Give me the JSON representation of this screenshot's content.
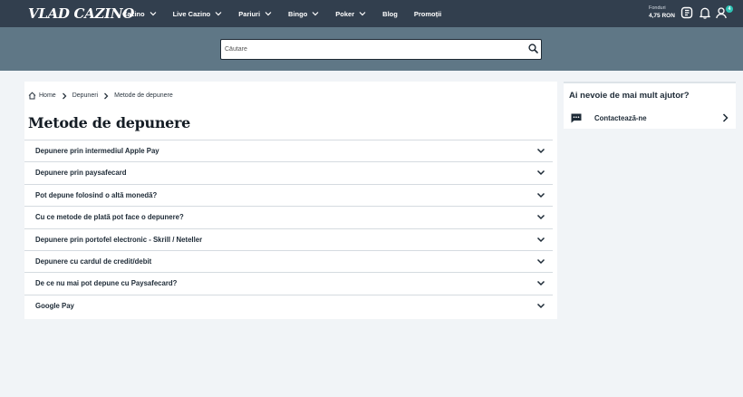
{
  "brand": {
    "logo_text": "VLAD CAZINO"
  },
  "nav": {
    "items": [
      {
        "label": "Cazino",
        "has_dropdown": true
      },
      {
        "label": "Live Cazino",
        "has_dropdown": true
      },
      {
        "label": "Pariuri",
        "has_dropdown": true
      },
      {
        "label": "Bingo",
        "has_dropdown": true
      },
      {
        "label": "Poker",
        "has_dropdown": true
      },
      {
        "label": "Blog",
        "has_dropdown": false
      },
      {
        "label": "Promoții",
        "has_dropdown": false
      }
    ]
  },
  "account": {
    "funds_label": "Fonduri",
    "funds_value": "4,75 RON",
    "notification_badge": "4",
    "icons": [
      "bonus-icon",
      "bell-icon",
      "user-icon"
    ]
  },
  "search": {
    "placeholder": "Căutare"
  },
  "breadcrumb": {
    "items": [
      "Home",
      "Depuneri",
      "Metode de depunere"
    ]
  },
  "page": {
    "title": "Metode de depunere"
  },
  "faq": {
    "items": [
      "Depunere prin intermediul Apple Pay",
      "Depunere prin paysafecard",
      "Pot depune folosind o altă monedă?",
      "Cu ce metode de plată pot face o depunere?",
      "Depunere prin portofel electronic - Skrill / Neteller",
      "Depunere cu cardul de credit/debit",
      "De ce nu mai pot depune cu Paysafecard?",
      "Google Pay"
    ]
  },
  "help": {
    "title": "Ai nevoie de mai mult ajutor?",
    "contact_label": "Contactează-ne"
  },
  "colors": {
    "topbar": "#323f4e",
    "search_band": "#5f7786",
    "page_bg": "#f1f4f7",
    "badge": "#2ec4b6"
  }
}
